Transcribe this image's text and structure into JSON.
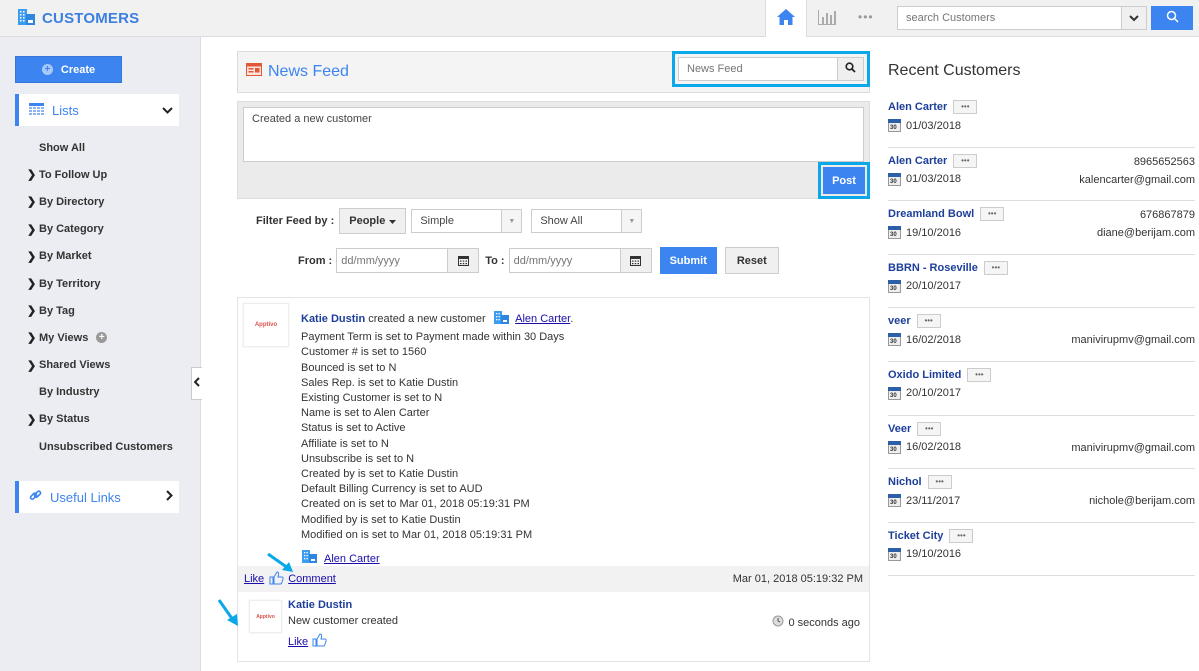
{
  "app": {
    "title": "CUSTOMERS",
    "search_placeholder": "search Customers",
    "more_label": "•••"
  },
  "colors": {
    "accent": "#3c84f0",
    "highlight": "#0aa8e8",
    "link": "#1d3f9a"
  },
  "sidebar": {
    "create_label": "Create",
    "lists_label": "Lists",
    "useful_links_label": "Useful Links",
    "items": [
      {
        "label": "Show All",
        "arrow": false
      },
      {
        "label": "To Follow Up",
        "arrow": true
      },
      {
        "label": "By Directory",
        "arrow": true
      },
      {
        "label": "By Category",
        "arrow": true
      },
      {
        "label": "By Market",
        "arrow": true
      },
      {
        "label": "By Territory",
        "arrow": true
      },
      {
        "label": "By Tag",
        "arrow": true
      },
      {
        "label": "My Views",
        "arrow": true,
        "add": true
      },
      {
        "label": "Shared Views",
        "arrow": true
      },
      {
        "label": "By Industry",
        "arrow": false
      },
      {
        "label": "By Status",
        "arrow": true
      },
      {
        "label": "Unsubscribed Customers",
        "arrow": false
      }
    ]
  },
  "newsfeed": {
    "title": "News Feed",
    "search_placeholder": "News Feed",
    "post_text": "Created a new customer",
    "post_label": "Post",
    "filter_label": "Filter Feed by :",
    "people_label": "People",
    "type_select": "Simple",
    "show_select": "Show All",
    "from_label": "From :",
    "to_label": "To :",
    "date_placeholder": "dd/mm/yyyy",
    "submit_label": "Submit",
    "reset_label": "Reset"
  },
  "feed_item": {
    "author": "Katie Dustin",
    "action": "created a new customer",
    "customer_link": "Alen Carter",
    "changes": [
      "Payment Term is set to Payment made within 30 Days",
      "Customer # is set to 1560",
      "Bounced is set to N",
      "Sales Rep. is set to Katie Dustin",
      "Existing Customer is set to N",
      "Name is set to Alen Carter",
      "Status is set to Active",
      "Affiliate is set to N",
      "Unsubscribe is set to N",
      "Created by is set to Katie Dustin",
      "Default Billing Currency is set to AUD",
      "Created on is set to Mar 01, 2018 05:19:31 PM",
      "Modified by is set to Katie Dustin",
      "Modified on is set to Mar 01, 2018 05:19:31 PM"
    ],
    "bottom_link": "Alen Carter",
    "like_label": "Like",
    "comment_label": "Comment",
    "timestamp": "Mar 01, 2018 05:19:32 PM",
    "avatar_text": "Apptivo",
    "comment": {
      "author": "Katie Dustin",
      "text": "New customer created",
      "like_label": "Like",
      "time": "0 seconds ago"
    }
  },
  "recent": {
    "title": "Recent Customers",
    "items": [
      {
        "name": "Alen Carter",
        "date": "01/03/2018",
        "phone": "",
        "email": ""
      },
      {
        "name": "Alen Carter",
        "date": "01/03/2018",
        "phone": "8965652563",
        "email": "kalencarter@gmail.com"
      },
      {
        "name": "Dreamland Bowl",
        "date": "19/10/2016",
        "phone": "676867879",
        "email": "diane@berijam.com"
      },
      {
        "name": "BBRN - Roseville",
        "date": "20/10/2017",
        "phone": "",
        "email": ""
      },
      {
        "name": "veer",
        "date": "16/02/2018",
        "phone": "",
        "email": "manivirupmv@gmail.com"
      },
      {
        "name": "Oxido Limited",
        "date": "20/10/2017",
        "phone": "",
        "email": ""
      },
      {
        "name": "Veer",
        "date": "16/02/2018",
        "phone": "",
        "email": "manivirupmv@gmail.com"
      },
      {
        "name": "Nichol",
        "date": "23/11/2017",
        "phone": "",
        "email": "nichole@berijam.com"
      },
      {
        "name": "Ticket City",
        "date": "19/10/2016",
        "phone": "",
        "email": ""
      }
    ]
  }
}
